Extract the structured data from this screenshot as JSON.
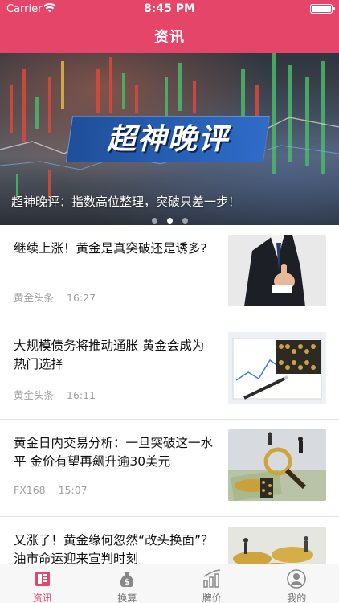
{
  "status_bar": {
    "carrier": "Carrier",
    "time": "8:45 PM"
  },
  "header": {
    "title": "资讯"
  },
  "banner": {
    "badge_text": "超神晚评",
    "caption": "超神晚评：指数高位整理，突破只差一步！",
    "dots_count": 3,
    "active_dot": 2
  },
  "news": [
    {
      "headline": "继续上涨！黄金是真突破还是诱多?",
      "source": "黄金头条",
      "time": "16:27",
      "thumb_icon": "businessman-thumbs-up-image"
    },
    {
      "headline": "大规模债务将推动通胀 黄金会成为热门选择",
      "source": "黄金头条",
      "time": "16:11",
      "thumb_icon": "abacus-chart-pen-image"
    },
    {
      "headline": "黄金日内交易分析：一旦突破这一水平 金价有望再飙升逾30美元",
      "source": "FX168",
      "time": "15:07",
      "thumb_icon": "magnifier-coins-money-image"
    },
    {
      "headline": "又涨了！黄金缘何忽然“改头换面”？油市命运迎来宣判时刻",
      "source": "",
      "time": "",
      "thumb_icon": "coins-figures-image"
    }
  ],
  "tabbar": {
    "items": [
      {
        "label": "资讯",
        "icon": "news-icon",
        "active": true
      },
      {
        "label": "换算",
        "icon": "money-bag-icon",
        "active": false
      },
      {
        "label": "牌价",
        "icon": "bar-chart-icon",
        "active": false
      },
      {
        "label": "我的",
        "icon": "profile-icon",
        "active": false
      }
    ]
  },
  "colors": {
    "accent": "#e6456a",
    "tab_inactive": "#777777",
    "meta_text": "#a0a0a0"
  }
}
